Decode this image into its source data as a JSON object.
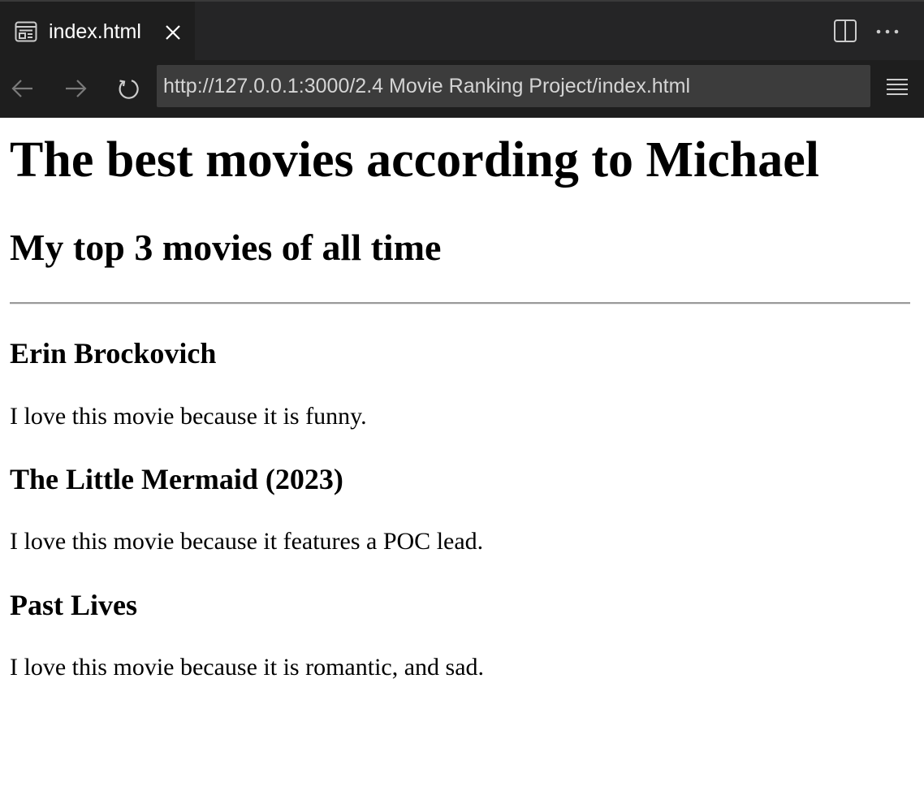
{
  "browser": {
    "tab": {
      "icon": "preview-icon",
      "title": "index.html"
    },
    "toolbar": {
      "url": "http://127.0.0.1:3000/2.4 Movie Ranking Project/index.html",
      "icons": [
        "back-arrow-icon",
        "forward-arrow-icon",
        "reload-icon",
        "split-editor-icon",
        "more-actions-icon",
        "menu-icon"
      ]
    },
    "colors": {
      "tabbar_bg": "#252526",
      "navbar_bg": "#1e1e1e",
      "urlbar_bg": "#3c3c3c",
      "page_bg": "#ffffff"
    }
  },
  "page": {
    "heading": "The best movies according to Michael",
    "subheading": "My top 3 movies of all time",
    "movies": [
      {
        "title": "Erin Brockovich",
        "reason": "I love this movie because it is funny."
      },
      {
        "title": "The Little Mermaid (2023)",
        "reason": "I love this movie because it features a POC lead."
      },
      {
        "title": "Past Lives",
        "reason": "I love this movie because it is romantic, and sad."
      }
    ]
  }
}
